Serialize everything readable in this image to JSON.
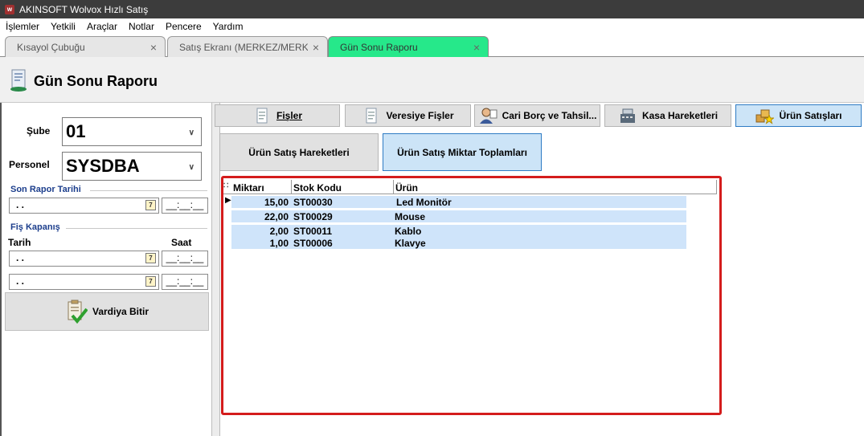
{
  "window": {
    "title": "AKINSOFT Wolvox Hızlı Satış"
  },
  "menu": [
    "İşlemler",
    "Yetkili",
    "Araçlar",
    "Notlar",
    "Pencere",
    "Yardım"
  ],
  "tabs": [
    {
      "label": "Kısayol Çubuğu"
    },
    {
      "label": "Satış Ekranı (MERKEZ/MERKEZ"
    },
    {
      "label": "Gün Sonu Raporu",
      "active": true
    }
  ],
  "page": {
    "title": "Gün Sonu Raporu"
  },
  "left": {
    "sube_label": "Şube",
    "sube_value": "01",
    "personel_label": "Personel",
    "personel_value": "SYSDBA",
    "son_rapor_label": "Son Rapor Tarihi",
    "son_rapor_date": ". .",
    "son_rapor_time": "__:__:__",
    "fis_kapanis_label": "Fiş Kapanış",
    "tarih_label": "Tarih",
    "saat_label": "Saat",
    "fis_date1": ". .",
    "fis_time1": "__:__:__",
    "fis_date2": ". .",
    "fis_time2": "__:__:__",
    "vardiya_label": "Vardiya Bitir",
    "cal_glyph": "7"
  },
  "toolbar": [
    {
      "label": "Fişler",
      "icon": "receipt-icon"
    },
    {
      "label": "Veresiye Fişler",
      "icon": "receipt-icon"
    },
    {
      "label": "Cari Borç ve Tahsil...",
      "icon": "person-icon"
    },
    {
      "label": "Kasa Hareketleri",
      "icon": "cash-register-icon"
    },
    {
      "label": "Ürün Satışları",
      "icon": "boxes-star-icon",
      "selected": true
    }
  ],
  "subtabs": [
    {
      "label": "Ürün Satış Hareketleri"
    },
    {
      "label": "Ürün Satış Miktar Toplamları",
      "selected": true
    }
  ],
  "grid": {
    "columns": [
      "Miktarı",
      "Stok Kodu",
      "Ürün"
    ],
    "rows": [
      {
        "miktar": "15,00",
        "stok_kodu": "ST00030",
        "urun": "Led Monitör"
      },
      {
        "miktar": "22,00",
        "stok_kodu": "ST00029",
        "urun": "Mouse"
      },
      {
        "miktar": "2,00",
        "stok_kodu": "ST00011",
        "urun": "Kablo"
      },
      {
        "miktar": "1,00",
        "stok_kodu": "ST00006",
        "urun": "Klavye"
      }
    ],
    "highlight_color": "#d41c1c"
  }
}
